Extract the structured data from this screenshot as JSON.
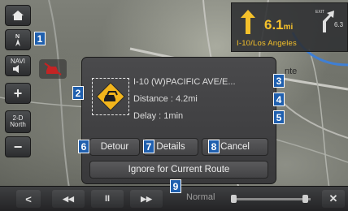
{
  "side_toolbar": {
    "home": "home-icon",
    "compass": "N",
    "navi_label": "NAVI",
    "zoom_in": "+",
    "view_mode": "2-D\nNorth",
    "zoom_out": "−"
  },
  "nav": {
    "distance_value": "6.1",
    "distance_unit": "mi",
    "road": "I-10/Los Angeles",
    "exit_label": "EXIT",
    "next_distance": "6.3"
  },
  "map": {
    "label": "nte"
  },
  "dialog": {
    "road_info": "I-10 (W)PACIFIC AVE/E...",
    "distance": "Distance : 4.2mi",
    "delay": "Delay : 1min",
    "buttons": {
      "detour": "Detour",
      "details": "Details",
      "cancel": "Cancel",
      "ignore": "Ignore for Current Route"
    }
  },
  "bottom": {
    "back": "<",
    "rewind": "◀◀",
    "pause": "II",
    "forward": "▶▶",
    "speed_label": "Normal",
    "close": "✕"
  },
  "callouts": {
    "c1": "1",
    "c2": "2",
    "c3": "3",
    "c4": "4",
    "c5": "5",
    "c6": "6",
    "c7": "7",
    "c8": "8",
    "c9": "9"
  },
  "colors": {
    "accent_yellow": "#f5c12b",
    "callout_blue": "#1f5fae",
    "traffic_icon_yellow": "#f2b51c"
  }
}
